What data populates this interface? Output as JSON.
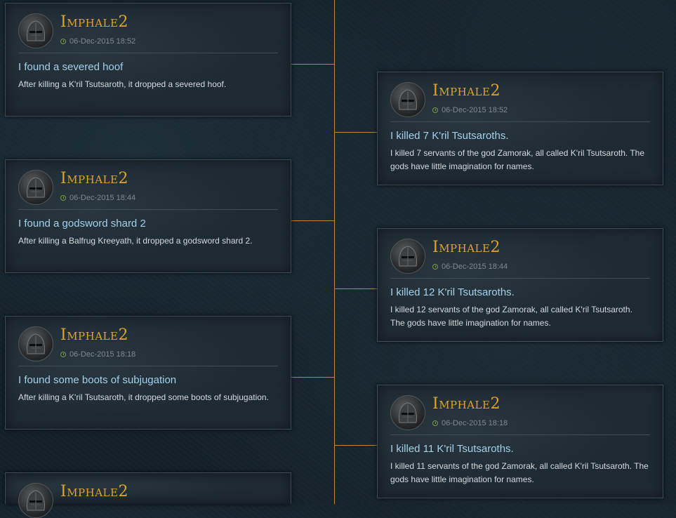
{
  "colors": {
    "accent_gold": "#e0a42c",
    "title_blue": "#a3d0ec",
    "timeline_line": "#c08a2a"
  },
  "icons": {
    "avatar": "knight-helmet-icon",
    "time": "clock-icon"
  },
  "entries": [
    {
      "player": "Imphale2",
      "time": "06-Dec-2015 18:52",
      "title": "I found a severed hoof",
      "text": "After killing a K'ril Tsutsaroth, it dropped a severed hoof."
    },
    {
      "player": "Imphale2",
      "time": "06-Dec-2015 18:52",
      "title": "I killed 7 K'ril Tsutsaroths.",
      "text": "I killed 7 servants of the god Zamorak, all called K'ril Tsutsaroth. The gods have little imagination for names."
    },
    {
      "player": "Imphale2",
      "time": "06-Dec-2015 18:44",
      "title": "I found a godsword shard 2",
      "text": "After killing a Balfrug Kreeyath, it dropped a godsword shard 2."
    },
    {
      "player": "Imphale2",
      "time": "06-Dec-2015 18:44",
      "title": "I killed 12 K'ril Tsutsaroths.",
      "text": "I killed 12 servants of the god Zamorak, all called K'ril Tsutsaroth. The gods have little imagination for names."
    },
    {
      "player": "Imphale2",
      "time": "06-Dec-2015 18:18",
      "title": "I found some boots of subjugation",
      "text": "After killing a K'ril Tsutsaroth, it dropped some boots of subjugation."
    },
    {
      "player": "Imphale2",
      "time": "06-Dec-2015 18:18",
      "title": "I killed 11 K'ril Tsutsaroths.",
      "text": "I killed 11 servants of the god Zamorak, all called K'ril Tsutsaroth. The gods have little imagination for names."
    },
    {
      "player": "Imphale2"
    }
  ]
}
